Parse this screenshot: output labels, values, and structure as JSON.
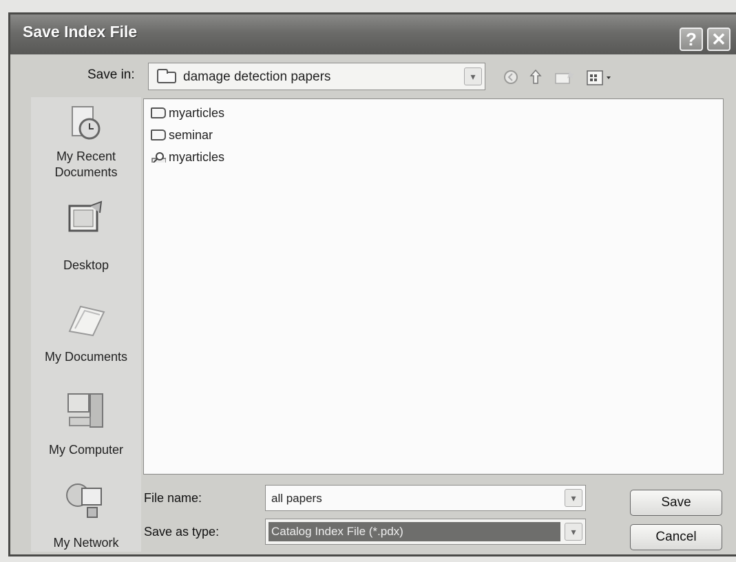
{
  "window": {
    "title": "Save Index File",
    "help_glyph": "?",
    "close_glyph": "✕"
  },
  "toolbar": {
    "save_in_label": "Save in:",
    "save_in_value": "damage detection papers",
    "icons": [
      "back-icon",
      "up-folder-icon",
      "new-folder-icon",
      "views-menu-icon"
    ]
  },
  "places": [
    {
      "label": "My Recent\nDocuments",
      "icon": "recent-documents-icon"
    },
    {
      "label": "Desktop",
      "icon": "desktop-icon"
    },
    {
      "label": "My Documents",
      "icon": "my-documents-icon"
    },
    {
      "label": "My Computer",
      "icon": "my-computer-icon"
    },
    {
      "label": "My Network",
      "icon": "my-network-icon"
    }
  ],
  "files": [
    {
      "name": "myarticles",
      "type": "folder"
    },
    {
      "name": "seminar",
      "type": "folder"
    },
    {
      "name": "myarticles",
      "type": "search"
    }
  ],
  "form": {
    "file_name_label": "File name:",
    "file_name_value": "all papers",
    "save_as_type_label": "Save as type:",
    "save_as_type_value": "Catalog Index File (*.pdx)"
  },
  "buttons": {
    "save": "Save",
    "cancel": "Cancel"
  }
}
